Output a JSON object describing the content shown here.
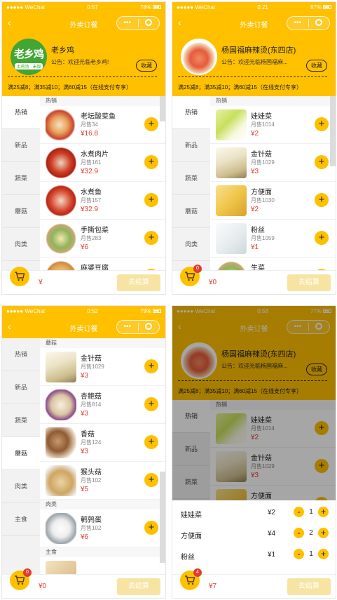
{
  "colors": {
    "accent": "#ffc000",
    "price": "#e23b2e",
    "checkout": "#f7e4a3"
  },
  "common": {
    "carrier": "●●●●● WeChat",
    "nav_title": "外卖订餐",
    "favorite": "收藏",
    "checkout": "去结算",
    "promo": "满25减8；满35减10；满60减15（在线支付专享）",
    "back_icon": "back-icon",
    "capsule_icons": [
      "more-dots-icon",
      "close-circle-icon"
    ],
    "cart_icon": "cart-icon"
  },
  "screens": [
    {
      "status": {
        "time": "0:57",
        "battery": "78%"
      },
      "shop": {
        "name": "老乡鸡",
        "notice": "公告：欢迎光临老乡鸡!",
        "logo_text": "老乡鸡",
        "logo_sub": "土鸡汤 · 米饭"
      },
      "categories": [
        "热销",
        "新品",
        "蔬菜",
        "蘑菇",
        "肉类"
      ],
      "active": 0,
      "sections": [
        {
          "title": "热销",
          "items": [
            {
              "name": "老坛酸菜鱼",
              "sales": "月售34",
              "price": "¥16.8",
              "img": "t-fish"
            },
            {
              "name": "水煮肉片",
              "sales": "月售161",
              "price": "¥32.9",
              "img": "t-meat"
            },
            {
              "name": "水煮鱼",
              "sales": "月售157",
              "price": "¥32.9",
              "img": "t-fish2"
            },
            {
              "name": "手撕包菜",
              "sales": "月售283",
              "price": "¥6",
              "img": "t-cabbage"
            },
            {
              "name": "麻婆豆腐",
              "sales": "",
              "price": "",
              "img": "t-tofu"
            }
          ]
        }
      ],
      "cart": {
        "badge": "",
        "total": "¥"
      }
    },
    {
      "status": {
        "time": "0:21",
        "battery": "87%"
      },
      "shop": {
        "name": "杨国福麻辣烫(东四店)",
        "notice": "公告：欢迎光临杨国福麻..."
      },
      "categories": [
        "热销",
        "新品",
        "蔬菜",
        "蘑菇",
        "肉类"
      ],
      "active": 0,
      "sections": [
        {
          "title": "热销",
          "items": [
            {
              "name": "娃娃菜",
              "sales": "月售1014",
              "price": "¥2",
              "img": "t-baby"
            },
            {
              "name": "金针菇",
              "sales": "月售1029",
              "price": "¥3",
              "img": "t-enoki"
            },
            {
              "name": "方便面",
              "sales": "月售1030",
              "price": "¥2",
              "img": "t-noodle"
            },
            {
              "name": "粉丝",
              "sales": "月售1059",
              "price": "¥1",
              "img": "t-vermi"
            },
            {
              "name": "生菜",
              "sales": "",
              "price": "",
              "img": "t-cabbage"
            }
          ]
        }
      ],
      "cart": {
        "badge": "0",
        "total": "¥0"
      }
    },
    {
      "status": {
        "time": "0:52",
        "battery": "79%"
      },
      "categories": [
        "热销",
        "新品",
        "蔬菜",
        "蘑菇",
        "肉类",
        "主食"
      ],
      "active": 3,
      "sections": [
        {
          "title": "蘑菇",
          "items": [
            {
              "name": "金针菇",
              "sales": "月售1029",
              "price": "¥3",
              "img": "t-enoki"
            },
            {
              "name": "杏鲍菇",
              "sales": "月售814",
              "price": "¥3",
              "img": "t-eryngii"
            },
            {
              "name": "香菇",
              "sales": "月售124",
              "price": "¥3",
              "img": "t-shiitake"
            },
            {
              "name": "猴头菇",
              "sales": "月售102",
              "price": "¥5",
              "img": "t-hericium"
            }
          ]
        },
        {
          "title": "肉类",
          "items": [
            {
              "name": "鹌鹑蛋",
              "sales": "月售102",
              "price": "¥6",
              "img": "t-egg"
            }
          ]
        },
        {
          "title": "主食",
          "items": [
            {
              "name": "",
              "sales": "",
              "price": "",
              "img": "t-staple"
            }
          ]
        }
      ],
      "cart": {
        "badge": "0",
        "total": "¥0"
      }
    },
    {
      "status": {
        "time": "0:58",
        "battery": "77%"
      },
      "shop": {
        "name": "杨国福麻辣烫(东四店)",
        "notice": "公告：欢迎光临杨国福麻..."
      },
      "categories": [
        "热销",
        "新品",
        "蔬菜",
        "蘑菇",
        "肉类"
      ],
      "active": 0,
      "sections": [
        {
          "title": "热销",
          "items": [
            {
              "name": "娃娃菜",
              "sales": "月售1014",
              "price": "¥2",
              "img": "t-baby"
            },
            {
              "name": "金针菇",
              "sales": "月售1029",
              "price": "¥3",
              "img": "t-enoki"
            },
            {
              "name": "方便面",
              "sales": "",
              "price": "",
              "img": "t-noodle"
            }
          ]
        }
      ],
      "popup": [
        {
          "name": "娃娃菜",
          "price": "¥2",
          "qty": "1"
        },
        {
          "name": "方便面",
          "price": "¥4",
          "qty": "2"
        },
        {
          "name": "粉丝",
          "price": "¥1",
          "qty": "1"
        }
      ],
      "stepper": {
        "minus": "-",
        "plus": "+"
      },
      "cart": {
        "badge": "4",
        "total": "¥7"
      }
    }
  ]
}
